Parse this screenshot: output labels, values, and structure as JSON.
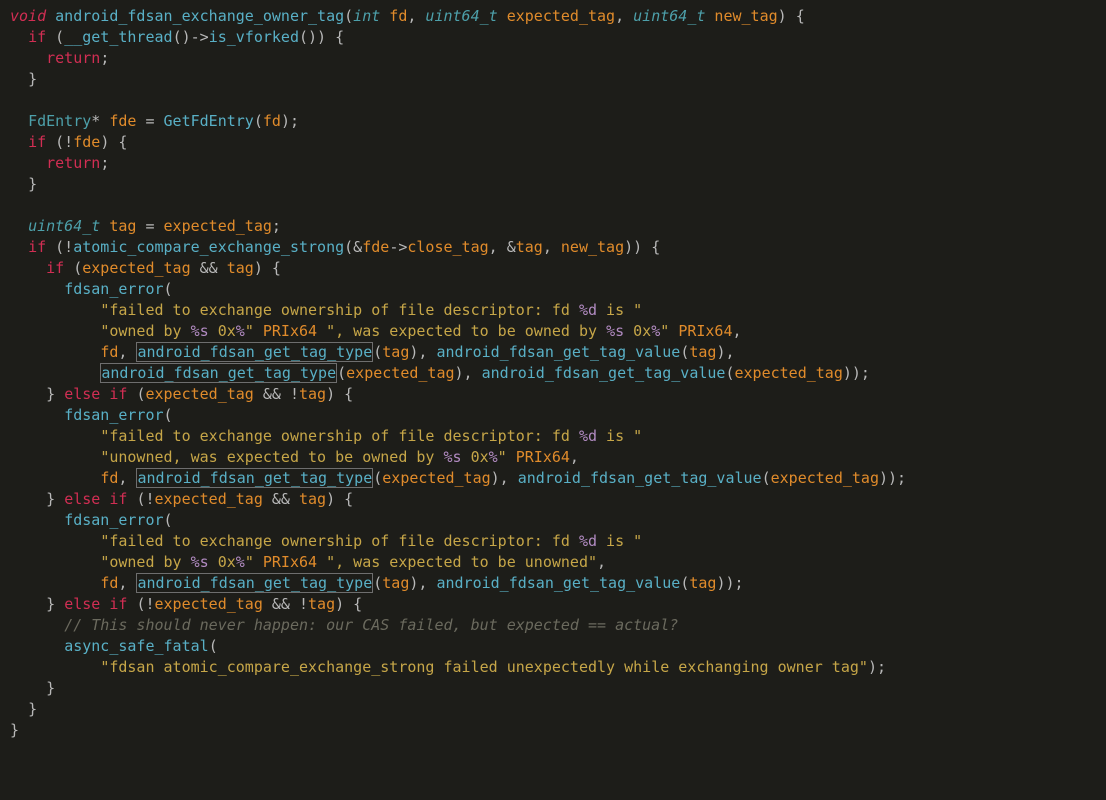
{
  "code": {
    "language": "C++",
    "function_signature": {
      "return_type": "void",
      "name": "android_fdsan_exchange_owner_tag",
      "params": [
        {
          "type": "int",
          "name": "fd"
        },
        {
          "type": "uint64_t",
          "name": "expected_tag"
        },
        {
          "type": "uint64_t",
          "name": "new_tag"
        }
      ]
    },
    "strings": {
      "fail_prefix": "\"failed to exchange ownership of file descriptor: fd %d is \"",
      "owned_by": "\"owned by %s 0x%\"",
      "was_expected_owned": "\", was expected to be owned by %s 0x%\"",
      "unowned_expected": "\"unowned, was expected to be owned by %s 0x%\"",
      "was_expected_unowned": "\", was expected to be unowned\"",
      "fatal": "\"fdsan atomic_compare_exchange_strong failed unexpectedly while exchanging owner tag\""
    },
    "identifiers": {
      "PRIx64": "PRIx64",
      "get_thread": "__get_thread",
      "is_vforked": "is_vforked",
      "FdEntry": "FdEntry",
      "fde": "fde",
      "GetFdEntry": "GetFdEntry",
      "tag": "tag",
      "atomic_cas": "atomic_compare_exchange_strong",
      "close_tag": "close_tag",
      "new_tag": "new_tag",
      "expected_tag": "expected_tag",
      "fd": "fd",
      "fdsan_error": "fdsan_error",
      "get_tag_type": "android_fdsan_get_tag_type",
      "get_tag_value": "android_fdsan_get_tag_value",
      "async_safe_fatal": "async_safe_fatal"
    },
    "keywords": {
      "void": "void",
      "int": "int",
      "uint64_t": "uint64_t",
      "if": "if",
      "else": "else",
      "return": "return"
    },
    "comment": "// This should never happen: our CAS failed, but expected == actual?",
    "highlighted_identifier": "android_fdsan_get_tag_type"
  }
}
